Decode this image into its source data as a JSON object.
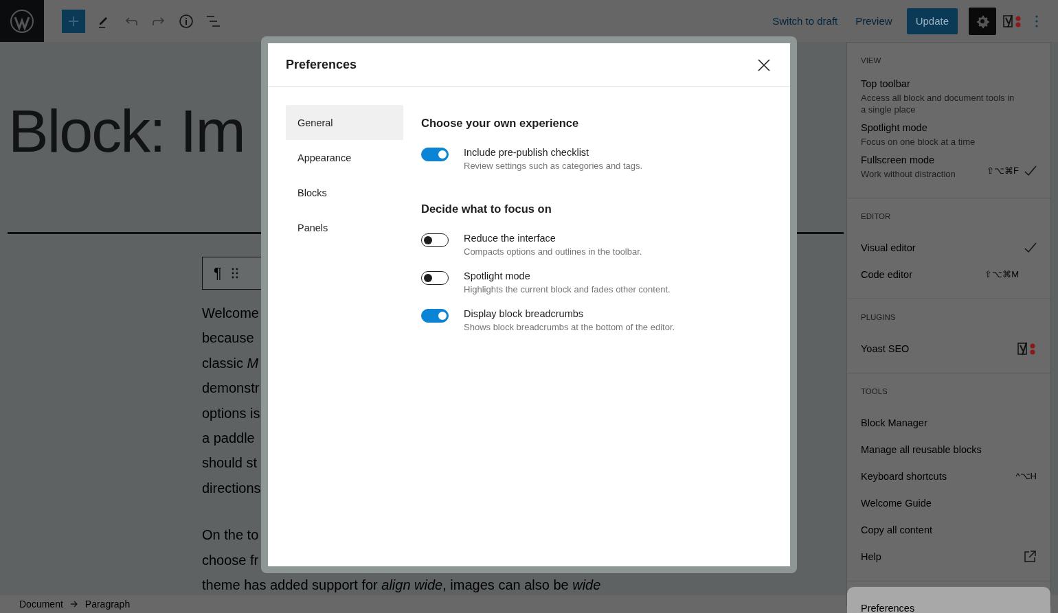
{
  "top_bar": {
    "links": [
      {
        "label": "Switch to draft"
      },
      {
        "label": "Preview"
      }
    ],
    "update_button": {
      "label": "Update"
    }
  },
  "editor": {
    "title": "Block: Im",
    "block_toolbar": {
      "paragraph_symbol": "¶"
    },
    "paragraphs": [
      [
        "Welcome",
        "because",
        "classic *M*",
        "demonstr",
        "options is",
        "a paddle",
        "should st",
        "directions"
      ],
      [
        "On the to",
        "choose fr",
        "theme has added support for *align wide*, images can also be *wide*"
      ]
    ]
  },
  "breadcrumb": [
    "Document",
    "Paragraph"
  ],
  "menu": {
    "sections": [
      {
        "label": "VIEW",
        "items": [
          {
            "kind": "check",
            "label": "Top toolbar",
            "description": "Access all block and document tools in a single place",
            "checked": false
          },
          {
            "kind": "check",
            "label": "Spotlight mode",
            "description": "Focus on one block at a time",
            "checked": false
          },
          {
            "kind": "check",
            "label": "Fullscreen mode",
            "description": "Work without distraction",
            "shortcut": "⇧⌥⌘F",
            "checked": true
          }
        ]
      },
      {
        "label": "EDITOR",
        "items": [
          {
            "kind": "check",
            "label": "Visual editor",
            "checked": true
          },
          {
            "kind": "check",
            "label": "Code editor",
            "shortcut": "⇧⌥⌘M",
            "checked": false
          }
        ]
      },
      {
        "label": "PLUGINS",
        "items": [
          {
            "kind": "plugin",
            "label": "Yoast SEO"
          }
        ]
      },
      {
        "label": "TOOLS",
        "items": [
          {
            "kind": "action",
            "label": "Block Manager"
          },
          {
            "kind": "action",
            "label": "Manage all reusable blocks"
          },
          {
            "kind": "action",
            "label": "Keyboard shortcuts",
            "shortcut": "^⌥H"
          },
          {
            "kind": "action",
            "label": "Welcome Guide"
          },
          {
            "kind": "action",
            "label": "Copy all content"
          },
          {
            "kind": "external",
            "label": "Help"
          }
        ]
      },
      {
        "items": [
          {
            "kind": "action",
            "label": "Preferences",
            "highlighted": true
          }
        ]
      }
    ]
  },
  "modal": {
    "title": "Preferences",
    "tabs": [
      {
        "label": "General",
        "selected": true
      },
      {
        "label": "Appearance",
        "selected": false
      },
      {
        "label": "Blocks",
        "selected": false
      },
      {
        "label": "Panels",
        "selected": false
      }
    ],
    "sections": [
      {
        "heading": "Choose your own experience",
        "options": [
          {
            "label": "Include pre-publish checklist",
            "description": "Review settings such as categories and tags.",
            "on": true
          }
        ]
      },
      {
        "heading": "Decide what to focus on",
        "options": [
          {
            "label": "Reduce the interface",
            "description": "Compacts options and outlines in the toolbar.",
            "on": false
          },
          {
            "label": "Spotlight mode",
            "description": "Highlights the current block and fades other content.",
            "on": false
          },
          {
            "label": "Display block breadcrumbs",
            "description": "Shows block breadcrumbs at the bottom of the editor.",
            "on": true
          }
        ]
      }
    ]
  }
}
